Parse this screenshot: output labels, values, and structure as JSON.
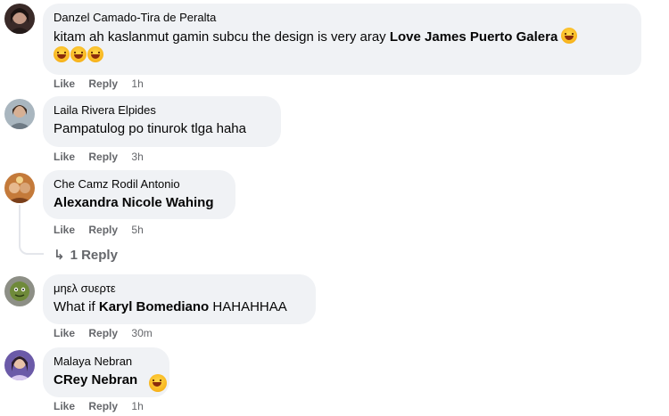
{
  "comments": [
    {
      "author": "Danzel Camado-Tira de Peralta",
      "text_before": "kitam ah kaslanmut gamin subcu the design is very aray ",
      "tag": "Love James Puerto Galera",
      "emoji_count": 4,
      "like": "Like",
      "reply": "Reply",
      "time": "1h"
    },
    {
      "author": "Laila Rivera Elpides",
      "text": "Pampatulog po tinurok tlga haha",
      "like": "Like",
      "reply": "Reply",
      "time": "3h"
    },
    {
      "author": "Che Camz Rodil Antonio",
      "tag": "Alexandra Nicole Wahing",
      "like": "Like",
      "reply": "Reply",
      "time": "5h",
      "replies_label": "1 Reply"
    },
    {
      "author": "μηελ συερτε",
      "text_before": "What if ",
      "tag": "Karyl Bomediano",
      "text_after": " HAHAHHAA",
      "like": "Like",
      "reply": "Reply",
      "time": "30m"
    },
    {
      "author": "Malaya Nebran",
      "tag": "CRey Nebran",
      "like": "Like",
      "reply": "Reply",
      "time": "1h"
    }
  ],
  "icons": {
    "reply_arrow": "reply-arrow-icon",
    "emoji": "laughing-emoji-icon"
  },
  "colors": {
    "bubble": "#f0f2f5",
    "meta_text": "#65676b",
    "text": "#050505"
  }
}
